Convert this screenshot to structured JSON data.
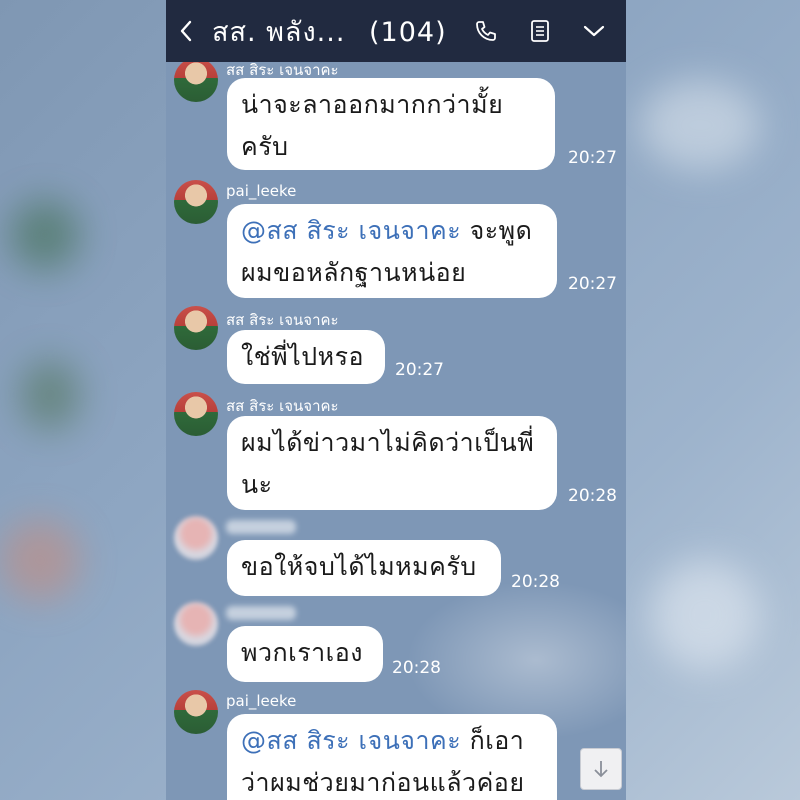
{
  "header": {
    "title": "สส. พลัง...",
    "member_count": "(104)",
    "icons": [
      "back-icon",
      "phone-icon",
      "notes-icon",
      "chevron-down-icon"
    ]
  },
  "messages": [
    {
      "sender": "สส สิระ เจนจาคะ",
      "lines": [
        "น่าจะลาออกมากกว่ามั้ย",
        "ครับ"
      ],
      "time": "20:27"
    },
    {
      "sender": "pai_leeke",
      "mention": "@สส สิระ เจนจาคะ",
      "line1_rest": "จะพูด",
      "line2": "ผมขอหลักฐานหน่อย",
      "time": "20:27"
    },
    {
      "sender": "สส สิระ เจนจาคะ",
      "lines": [
        "ใช่พี่ไปหรอ"
      ],
      "time": "20:27"
    },
    {
      "sender": "สส สิระ เจนจาคะ",
      "lines": [
        "ผมได้ข่าวมาไม่คิดว่าเป็นพี่",
        "นะ"
      ],
      "time": "20:28"
    },
    {
      "sender": "",
      "lines": [
        "ขอให้จบได้ไมหมครับ"
      ],
      "time": "20:28"
    },
    {
      "sender": "",
      "lines": [
        "พวกเราเอง"
      ],
      "time": "20:28"
    },
    {
      "sender": "pai_leeke",
      "mention": "@สส สิระ เจนจาคะ",
      "line1_rest": "ก็เอา",
      "line2": "ว่าผมช่วยมาก่อนแล้วค่อย"
    }
  ],
  "colors": {
    "header_bg": "#212a40",
    "chat_bg": "#7e97b6",
    "mention": "#3d70b8",
    "bubble": "#ffffff"
  }
}
